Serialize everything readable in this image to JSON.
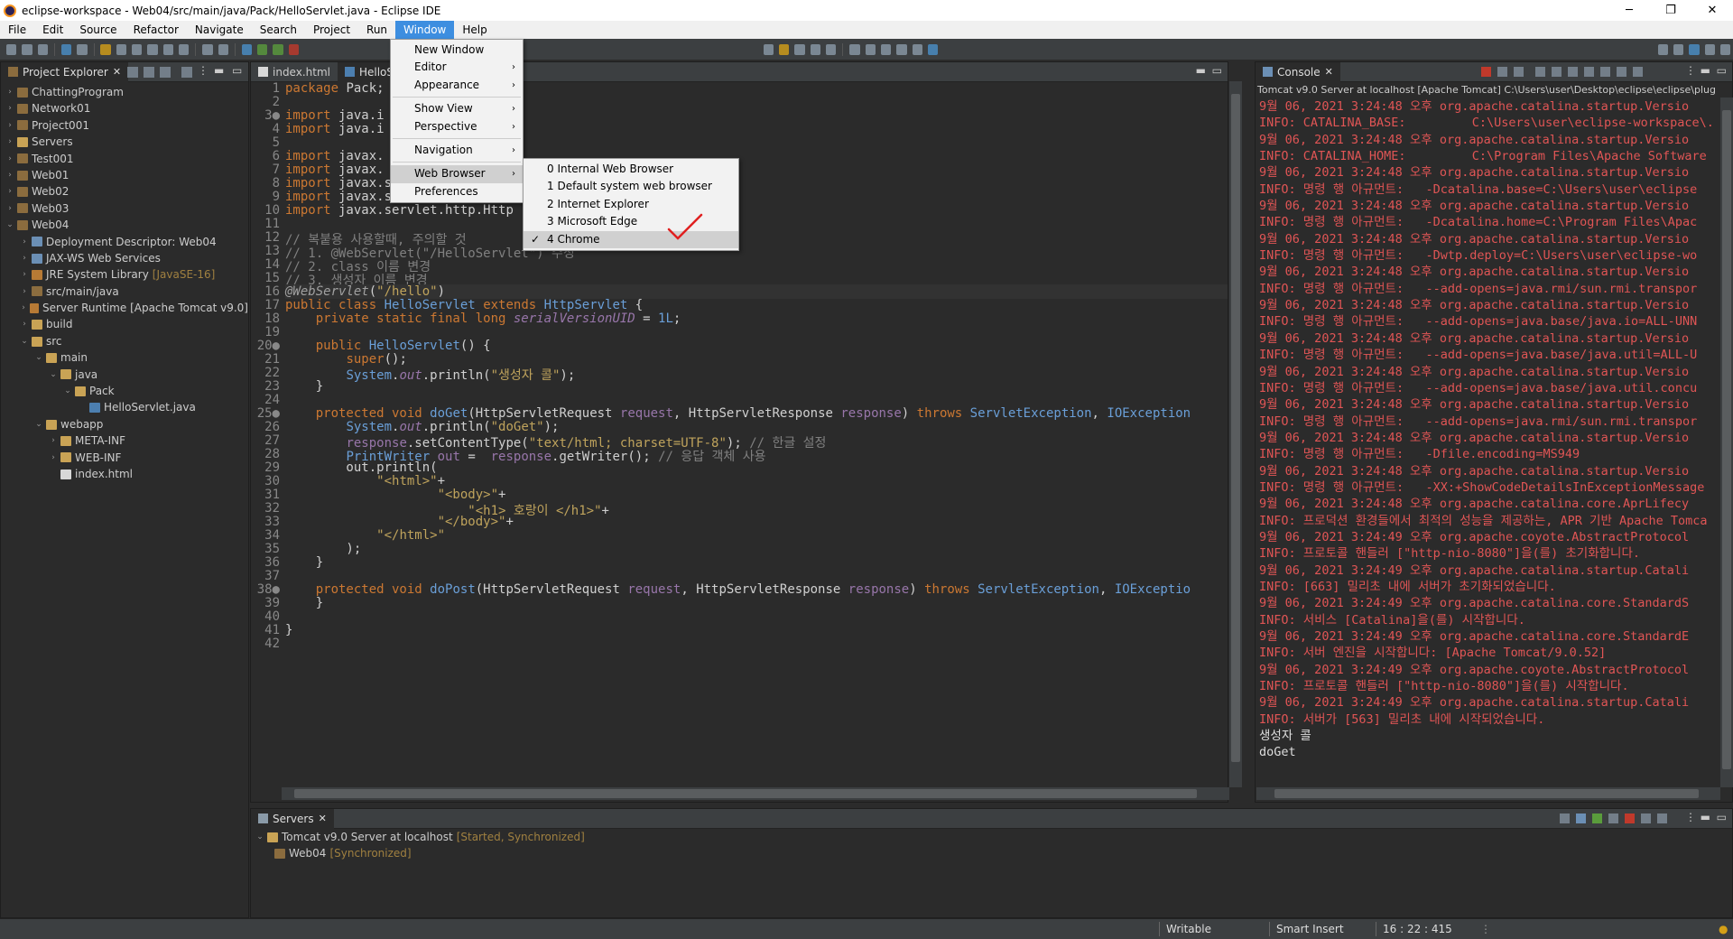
{
  "window": {
    "title": "eclipse-workspace - Web04/src/main/java/Pack/HelloServlet.java - Eclipse IDE",
    "minimize": "─",
    "maximize": "❐",
    "close": "✕"
  },
  "menubar": {
    "items": [
      "File",
      "Edit",
      "Source",
      "Refactor",
      "Navigate",
      "Search",
      "Project",
      "Run",
      "Window",
      "Help"
    ],
    "active": "Window"
  },
  "project_explorer": {
    "tab_label": "Project Explorer",
    "items": [
      {
        "label": "ChattingProgram",
        "indent": 0,
        "twisty": "›",
        "icon": "proj"
      },
      {
        "label": "Network01",
        "indent": 0,
        "twisty": "›",
        "icon": "proj"
      },
      {
        "label": "Project001",
        "indent": 0,
        "twisty": "›",
        "icon": "proj"
      },
      {
        "label": "Servers",
        "indent": 0,
        "twisty": "›",
        "icon": "fold"
      },
      {
        "label": "Test001",
        "indent": 0,
        "twisty": "›",
        "icon": "proj"
      },
      {
        "label": "Web01",
        "indent": 0,
        "twisty": "›",
        "icon": "proj"
      },
      {
        "label": "Web02",
        "indent": 0,
        "twisty": "›",
        "icon": "proj"
      },
      {
        "label": "Web03",
        "indent": 0,
        "twisty": "›",
        "icon": "proj"
      },
      {
        "label": "Web04",
        "indent": 0,
        "twisty": "⌄",
        "icon": "proj"
      },
      {
        "label": "Deployment Descriptor: Web04",
        "indent": 1,
        "twisty": "›",
        "icon": "ws"
      },
      {
        "label": "JAX-WS Web Services",
        "indent": 1,
        "twisty": "›",
        "icon": "ws"
      },
      {
        "label": "JRE System Library",
        "decoration": "[JavaSE-16]",
        "indent": 1,
        "twisty": "›",
        "icon": "lib"
      },
      {
        "label": "src/main/java",
        "indent": 1,
        "twisty": "›",
        "icon": "pkg"
      },
      {
        "label": "Server Runtime [Apache Tomcat v9.0]",
        "indent": 1,
        "twisty": "›",
        "icon": "lib"
      },
      {
        "label": "build",
        "indent": 1,
        "twisty": "›",
        "icon": "fold"
      },
      {
        "label": "src",
        "indent": 1,
        "twisty": "⌄",
        "icon": "fold"
      },
      {
        "label": "main",
        "indent": 2,
        "twisty": "⌄",
        "icon": "fold"
      },
      {
        "label": "java",
        "indent": 3,
        "twisty": "⌄",
        "icon": "fold"
      },
      {
        "label": "Pack",
        "indent": 4,
        "twisty": "⌄",
        "icon": "fold"
      },
      {
        "label": "HelloServlet.java",
        "indent": 5,
        "twisty": "",
        "icon": "java"
      },
      {
        "label": "webapp",
        "indent": 2,
        "twisty": "⌄",
        "icon": "fold"
      },
      {
        "label": "META-INF",
        "indent": 3,
        "twisty": "›",
        "icon": "fold"
      },
      {
        "label": "WEB-INF",
        "indent": 3,
        "twisty": "›",
        "icon": "fold"
      },
      {
        "label": "index.html",
        "indent": 3,
        "twisty": "",
        "icon": "file"
      }
    ]
  },
  "editor": {
    "tabs": [
      {
        "label": "index.html"
      },
      {
        "label": "HelloS"
      }
    ],
    "lines": [
      "<span class='kw'>package</span> Pack;",
      "",
      "<span class='kw'>import</span> java.i",
      "<span class='kw'>import</span> java.i",
      "",
      "<span class='kw'>import</span> javax.",
      "<span class='kw'>import</span> javax.",
      "<span class='kw'>import</span> javax.servlet.http.Http",
      "<span class='kw'>import</span> javax.servlet.http.Http",
      "<span class='kw'>import</span> javax.servlet.http.Http",
      "",
      "<span class='cm'>// 복붙용 사용할때, 주의할 것</span>",
      "<span class='cm'>// 1. @WebServlet(\"/HelloServlet\") 수정</span>",
      "<span class='cm'>// 2. class 이름 변경</span>",
      "<span class='cm'>// 3. 생성자 이름 변경</span>",
      "<span class='an'>@WebServlet</span>(<span class='st'>\"/hello\"</span>)",
      "<span class='kw'>public class</span> <span class='ty'>HelloServlet</span> <span class='kw'>extends</span> <span class='ty'>HttpServlet</span> {",
      "    <span class='kw'>private static final long</span> <span class='fd it'>serialVersionUID</span> = <span class='ty'>1L</span>;",
      "",
      "    <span class='kw'>public</span> <span class='ty'>HelloServlet</span>() {",
      "        <span class='kw'>super</span>();",
      "        <span class='ty'>System</span>.<span class='fd it'>out</span>.println(<span class='st'>\"생성자 콜\"</span>);",
      "    }",
      "",
      "    <span class='kw'>protected void</span> <span class='ty'>doGet</span>(HttpServletRequest <span class='fd'>request</span>, HttpServletResponse <span class='fd'>response</span>) <span class='kw'>throws</span> <span class='ty'>ServletException</span>, <span class='ty'>IOException</span>",
      "        <span class='ty'>System</span>.<span class='fd it'>out</span>.println(<span class='st'>\"doGet\"</span>);",
      "        <span class='fd'>response</span>.setContentType(<span class='st'>\"text/html; charset=UTF-8\"</span>); <span class='cm'>// 한글 설정</span>",
      "        <span class='ty'>PrintWriter</span> <span class='fd'>out</span> =  <span class='fd'>response</span>.getWriter(); <span class='cm'>// 응답 객체 사용</span>",
      "        out.println(",
      "            <span class='st'>\"&lt;html&gt;\"</span>+",
      "                    <span class='st'>\"&lt;body&gt;\"</span>+",
      "                        <span class='st'>\"&lt;h1&gt; 호랑이 &lt;/h1&gt;\"</span>+",
      "                    <span class='st'>\"&lt;/body&gt;\"</span>+",
      "            <span class='st'>\"&lt;/html&gt;\"</span>",
      "        );",
      "    }",
      "",
      "    <span class='kw'>protected void</span> <span class='ty'>doPost</span>(HttpServletRequest <span class='fd'>request</span>, HttpServletResponse <span class='fd'>response</span>) <span class='kw'>throws</span> <span class='ty'>ServletException</span>, <span class='ty'>IOExceptio</span>",
      "    }",
      "",
      "}",
      ""
    ],
    "markers": {
      "3": "3●",
      "20": "20●",
      "25": "25●",
      "38": "38●"
    }
  },
  "window_menu": {
    "items": [
      {
        "label": "New Window",
        "arrow": false
      },
      {
        "label": "Editor",
        "arrow": true
      },
      {
        "label": "Appearance",
        "arrow": true
      },
      {
        "sep": true
      },
      {
        "label": "Show View",
        "arrow": true
      },
      {
        "label": "Perspective",
        "arrow": true
      },
      {
        "sep": true
      },
      {
        "label": "Navigation",
        "arrow": true
      },
      {
        "sep": true
      },
      {
        "label": "Web Browser",
        "arrow": true,
        "highlight": true
      },
      {
        "label": "Preferences",
        "arrow": false
      }
    ]
  },
  "web_browser_menu": {
    "items": [
      {
        "label": "0 Internal Web Browser",
        "checked": false
      },
      {
        "label": "1 Default system web browser",
        "checked": false
      },
      {
        "label": "2 Internet Explorer",
        "checked": false
      },
      {
        "label": "3 Microsoft Edge",
        "checked": false
      },
      {
        "label": "4 Chrome",
        "checked": true,
        "highlight": true
      }
    ]
  },
  "console": {
    "tab_label": "Console",
    "header": "Tomcat v9.0 Server at localhost [Apache Tomcat] C:\\Users\\user\\Desktop\\eclipse\\eclipse\\plug",
    "lines": [
      {
        "t": "9월 06, 2021 3:24:48 오후 org.apache.catalina.startup.Versio",
        "w": false
      },
      {
        "t": "INFO: CATALINA_BASE:         C:\\Users\\user\\eclipse-workspace\\.",
        "w": false
      },
      {
        "t": "9월 06, 2021 3:24:48 오후 org.apache.catalina.startup.Versio",
        "w": false
      },
      {
        "t": "INFO: CATALINA_HOME:         C:\\Program Files\\Apache Software ",
        "w": false
      },
      {
        "t": "9월 06, 2021 3:24:48 오후 org.apache.catalina.startup.Versio",
        "w": false
      },
      {
        "t": "INFO: 명령 행 아규먼트:   -Dcatalina.base=C:\\Users\\user\\eclipse",
        "w": false
      },
      {
        "t": "9월 06, 2021 3:24:48 오후 org.apache.catalina.startup.Versio",
        "w": false
      },
      {
        "t": "INFO: 명령 행 아규먼트:   -Dcatalina.home=C:\\Program Files\\Apac",
        "w": false
      },
      {
        "t": "9월 06, 2021 3:24:48 오후 org.apache.catalina.startup.Versio",
        "w": false
      },
      {
        "t": "INFO: 명령 행 아규먼트:   -Dwtp.deploy=C:\\Users\\user\\eclipse-wo",
        "w": false
      },
      {
        "t": "9월 06, 2021 3:24:48 오후 org.apache.catalina.startup.Versio",
        "w": false
      },
      {
        "t": "INFO: 명령 행 아규먼트:   --add-opens=java.rmi/sun.rmi.transpor",
        "w": false
      },
      {
        "t": "9월 06, 2021 3:24:48 오후 org.apache.catalina.startup.Versio",
        "w": false
      },
      {
        "t": "INFO: 명령 행 아규먼트:   --add-opens=java.base/java.io=ALL-UNN",
        "w": false
      },
      {
        "t": "9월 06, 2021 3:24:48 오후 org.apache.catalina.startup.Versio",
        "w": false
      },
      {
        "t": "INFO: 명령 행 아규먼트:   --add-opens=java.base/java.util=ALL-U",
        "w": false
      },
      {
        "t": "9월 06, 2021 3:24:48 오후 org.apache.catalina.startup.Versio",
        "w": false
      },
      {
        "t": "INFO: 명령 행 아규먼트:   --add-opens=java.base/java.util.concu",
        "w": false
      },
      {
        "t": "9월 06, 2021 3:24:48 오후 org.apache.catalina.startup.Versio",
        "w": false
      },
      {
        "t": "INFO: 명령 행 아규먼트:   --add-opens=java.rmi/sun.rmi.transpor",
        "w": false
      },
      {
        "t": "9월 06, 2021 3:24:48 오후 org.apache.catalina.startup.Versio",
        "w": false
      },
      {
        "t": "INFO: 명령 행 아규먼트:   -Dfile.encoding=MS949",
        "w": false
      },
      {
        "t": "9월 06, 2021 3:24:48 오후 org.apache.catalina.startup.Versio",
        "w": false
      },
      {
        "t": "INFO: 명령 행 아규먼트:   -XX:+ShowCodeDetailsInExceptionMessage",
        "w": false
      },
      {
        "t": "9월 06, 2021 3:24:48 오후 org.apache.catalina.core.AprLifecy",
        "w": false
      },
      {
        "t": "INFO: 프로덕션 환경들에서 최적의 성능을 제공하는, APR 기반 Apache Tomca",
        "w": false
      },
      {
        "t": "9월 06, 2021 3:24:49 오후 org.apache.coyote.AbstractProtocol",
        "w": false
      },
      {
        "t": "INFO: 프로토콜 핸들러 [\"http-nio-8080\"]을(를) 초기화합니다.",
        "w": false
      },
      {
        "t": "9월 06, 2021 3:24:49 오후 org.apache.catalina.startup.Catali",
        "w": false
      },
      {
        "t": "INFO: [663] 밀리초 내에 서버가 초기화되었습니다.",
        "w": false
      },
      {
        "t": "9월 06, 2021 3:24:49 오후 org.apache.catalina.core.StandardS",
        "w": false
      },
      {
        "t": "INFO: 서비스 [Catalina]을(를) 시작합니다.",
        "w": false
      },
      {
        "t": "9월 06, 2021 3:24:49 오후 org.apache.catalina.core.StandardE",
        "w": false
      },
      {
        "t": "INFO: 서버 엔진을 시작합니다: [Apache Tomcat/9.0.52]",
        "w": false
      },
      {
        "t": "9월 06, 2021 3:24:49 오후 org.apache.coyote.AbstractProtocol",
        "w": false
      },
      {
        "t": "INFO: 프로토콜 핸들러 [\"http-nio-8080\"]을(를) 시작합니다.",
        "w": false
      },
      {
        "t": "9월 06, 2021 3:24:49 오후 org.apache.catalina.startup.Catali",
        "w": false
      },
      {
        "t": "INFO: 서버가 [563] 밀리초 내에 시작되었습니다.",
        "w": false
      },
      {
        "t": "생성자 콜",
        "w": true
      },
      {
        "t": "doGet",
        "w": true
      }
    ]
  },
  "servers": {
    "tab_label": "Servers",
    "server": "Tomcat v9.0 Server at localhost",
    "server_state": "[Started, Synchronized]",
    "module": "Web04",
    "module_state": "[Synchronized]"
  },
  "statusbar": {
    "writable": "Writable",
    "insert": "Smart Insert",
    "position": "16 : 22 : 415"
  },
  "colors": {
    "accent": "#3d8ee0",
    "checkmark": "#e02020"
  }
}
